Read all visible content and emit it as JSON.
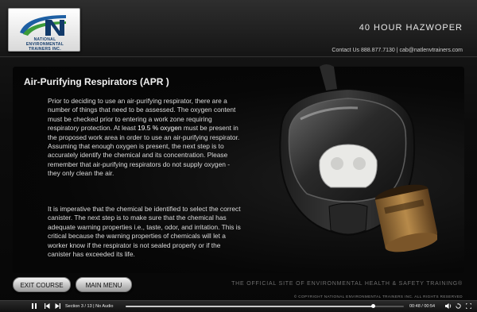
{
  "header": {
    "logo_text": [
      "NATIONAL",
      "ENVIRONMENTAL",
      "TRAINERS INC."
    ],
    "course_title": "40 HOUR HAZWOPER",
    "contact": "Contact Us 888.877.7130 | cab@natlenvtrainers.com"
  },
  "slide": {
    "heading": "Air-Purifying Respirators (APR )",
    "para1_before": "Prior to deciding to use an air-purifying respirator, there are a number of things that need to be assessed. The oxygen content must be checked prior to entering a work zone requiring respiratory protection. At least ",
    "para1_highlight": "19.5 % oxygen",
    "para1_after": " must be present in the proposed work area in order to use an air-purifying respirator. Assuming that enough oxygen is present, the next step is to accurately identify the chemical and its concentration. Please remember that air-purifying respirators do not supply oxygen - they only clean the air.",
    "para2": "It is imperative that the chemical be identified to select the correct canister. The next step is to make sure that the chemical has adequate warning properties i.e., taste, odor, and irritation. This is critical because the warning properties of chemicals will let a worker know if the respirator is not sealed properly or if the canister has exceeded its life."
  },
  "footer": {
    "exit_label": "EXIT COURSE",
    "menu_label": "MAIN MENU",
    "tagline": "THE OFFICIAL SITE OF ENVIRONMENTAL HEALTH & SAFETY TRAINING®",
    "copyright": "© COPYRIGHT NATIONAL ENVIRONMENTAL TRAINERS INC. ALL RIGHTS RESERVED"
  },
  "player": {
    "play_icon": "pause-icon",
    "section_info": "Section 3 / 13 | No Audio",
    "time": "00:48 / 00:54",
    "progress": 0.89,
    "colors": {
      "accent": "#ffffff",
      "track": "#555555"
    }
  }
}
